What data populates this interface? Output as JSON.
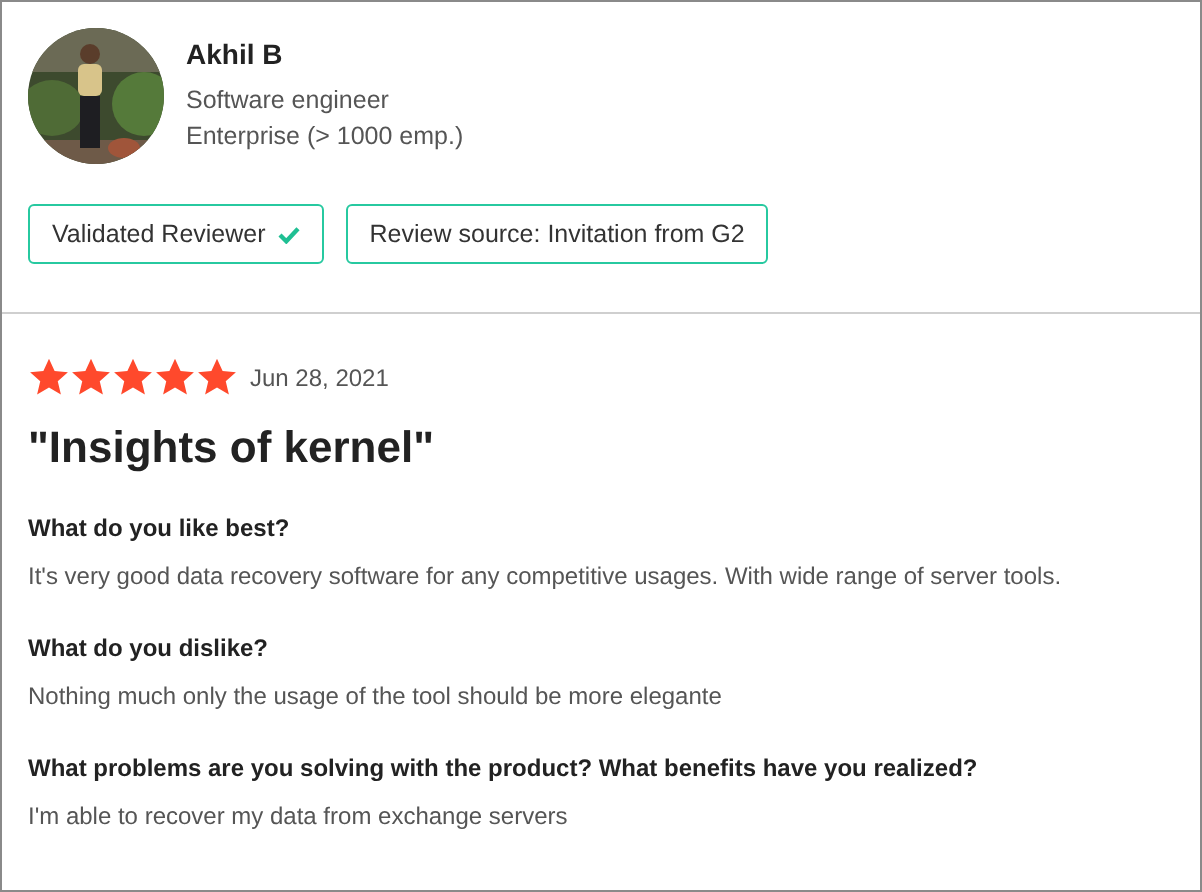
{
  "reviewer": {
    "name": "Akhil B",
    "role": "Software engineer",
    "company": "Enterprise (> 1000 emp.)"
  },
  "badges": [
    {
      "label": "Validated Reviewer",
      "verified": true
    },
    {
      "label": "Review source: Invitation from G2",
      "verified": false
    }
  ],
  "review": {
    "stars": 5,
    "date": "Jun 28, 2021",
    "title": "\"Insights of kernel\"",
    "sections": [
      {
        "question": "What do you like best?",
        "answer": "It's very good data recovery software for any competitive usages. With wide range of server tools."
      },
      {
        "question": "What do you dislike?",
        "answer": "Nothing much only the usage of the tool should be more elegante"
      },
      {
        "question": "What problems are you solving with the product? What benefits have you realized?",
        "answer": "I'm able to recover my data from exchange servers"
      }
    ]
  }
}
